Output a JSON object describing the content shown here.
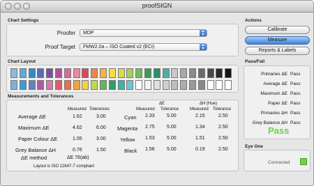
{
  "window": {
    "title": "proofSIGN"
  },
  "chart_settings": {
    "heading": "Chart Settings",
    "proofer_label": "Proofer",
    "proofer_value": "MDP",
    "target_label": "Proof Target",
    "target_value": "FMW2.0a – ISO Coated v2 (ECI)"
  },
  "chart_layout": {
    "heading": "Chart Layout",
    "row1_colors": [
      "#8fb8dc",
      "#62a9d8",
      "#2a8fcb",
      "#5d6cb3",
      "#7c4f99",
      "#b5519b",
      "#d96a9c",
      "#e58aa3",
      "#d94a55",
      "#e88a4a",
      "#f3b440",
      "#f6df3c",
      "#d8dc48",
      "#a9cf52",
      "#72bb5b",
      "#3d9b53",
      "#2f8d6a",
      "#4ab0a5",
      "#c9c9c9",
      "#a9a9a9",
      "#8a8a8a",
      "#6a6a6a",
      "#4a4a4a",
      "#2a2a2a",
      "#151515"
    ],
    "row2_colors": [
      "#7fb0dc",
      "#3c9bd4",
      "#6a7fc2",
      "#b05aa0",
      "#d67ba8",
      "#e05a6a",
      "#e9704a",
      "#f0a346",
      "#f4d04a",
      "#c4d750",
      "#5fb75c",
      "#399a6a",
      "#3fb3ad",
      "#6fc4d6",
      "#ffffff",
      "#f2f2f2",
      "#e0e0e0",
      "#cfcfcf",
      "#bdbdbd",
      "#acacac",
      "#9a9a9a",
      "#888888",
      "#ffffff",
      "#ffffff",
      "#ffffff"
    ]
  },
  "measurements": {
    "heading": "Measurements and Tolerances",
    "col_measured": "Measured",
    "col_tolerances": "Tolerances",
    "rows": [
      {
        "label": "Average ΔE",
        "measured": "1.62",
        "tolerance": "3.00"
      },
      {
        "label": "Maximum ΔE",
        "measured": "4.62",
        "tolerance": "6.00"
      },
      {
        "label": "Paper Colour ΔE",
        "measured": "1.05",
        "tolerance": "3.00"
      },
      {
        "label": "Grey Balance ΔH",
        "measured": "0.76",
        "tolerance": "1.50"
      }
    ],
    "method_label": "ΔE method",
    "method_value": "ΔE 76(ab)",
    "compliance_note": "Layout is ISO 12647-7 compliant",
    "de_heading": "ΔE",
    "dh_heading": "ΔH (Hue)",
    "col_measured2": "Measured",
    "col_tolerance2": "Tolerance",
    "col_measured3": "Measured",
    "col_tolerance3": "Tolerance",
    "inks": [
      {
        "name": "Cyan",
        "de_measured": "2.33",
        "de_tol": "5.00",
        "dh_measured": "2.15",
        "dh_tol": "2.50"
      },
      {
        "name": "Magenta",
        "de_measured": "2.75",
        "de_tol": "5.00",
        "dh_measured": "1.34",
        "dh_tol": "2.50"
      },
      {
        "name": "Yellow",
        "de_measured": "1.53",
        "de_tol": "5.00",
        "dh_measured": "1.51",
        "dh_tol": "2.50"
      },
      {
        "name": "Black",
        "de_measured": "1.56",
        "de_tol": "5.00",
        "dh_measured": "0.19",
        "dh_tol": "2.50"
      }
    ]
  },
  "actions": {
    "heading": "Actions",
    "calibrate": "Calibrate",
    "measure": "Measure",
    "reports": "Reports & Labels"
  },
  "pass_fail": {
    "heading": "Pass/Fail",
    "items": [
      {
        "label": "Primaries ΔE",
        "value": "Pass"
      },
      {
        "label": "Average ΔE",
        "value": "Pass"
      },
      {
        "label": "Maximum ΔE",
        "value": "Pass"
      },
      {
        "label": "Paper ΔE",
        "value": "Pass"
      },
      {
        "label": "Primaries ΔH",
        "value": "Pass"
      },
      {
        "label": "Grey Balance ΔH",
        "value": "Pass"
      }
    ],
    "result": "Pass",
    "result_color": "#66d548"
  },
  "eye_one": {
    "heading": "Eye One",
    "status": "Connected",
    "status_color": "#66d548"
  }
}
